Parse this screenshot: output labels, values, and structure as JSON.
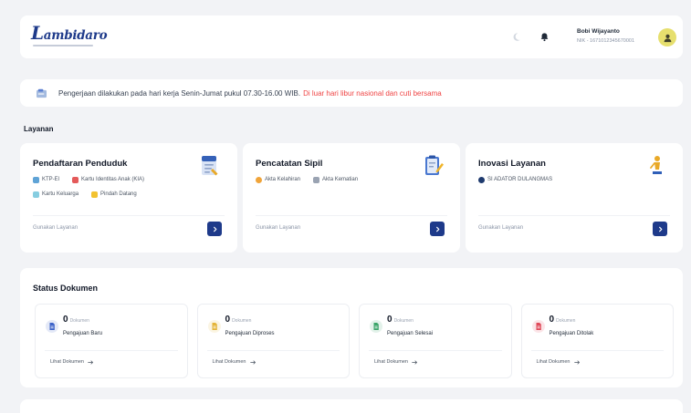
{
  "header": {
    "logo_text": "Lambidaro",
    "user_name": "Bobi Wijayanto",
    "user_id": "NIK - 1671012345670001",
    "icons": {
      "theme": "moon-icon",
      "notification": "bell-icon",
      "avatar": "user-avatar-icon"
    }
  },
  "notice": {
    "icon": "document-icon",
    "text": "Pengerjaan dilakukan pada hari kerja Senin-Jumat pukul 07.30-16.00 WIB.",
    "highlight": "Di luar hari libur nasional dan cuti bersama",
    "highlight_color": "#ef4444"
  },
  "services": {
    "title": "Layanan",
    "cards": [
      {
        "title": "Pendaftaran Penduduk",
        "icon": "id-document-icon",
        "items": [
          {
            "label": "KTP-El",
            "icon": "id-card-icon",
            "color": "#5fa3d6"
          },
          {
            "label": "Kartu Identitas Anak (KIA)",
            "icon": "child-card-icon",
            "color": "#e45a5a"
          },
          {
            "label": "Kartu Keluarga",
            "icon": "family-card-icon",
            "color": "#86cde0"
          },
          {
            "label": "Pindah Datang",
            "icon": "moving-icon",
            "color": "#f2c230"
          }
        ],
        "action_label": "Gunakan Layanan"
      },
      {
        "title": "Pencatatan Sipil",
        "icon": "clipboard-pen-icon",
        "items": [
          {
            "label": "Akta Kelahiran",
            "icon": "birth-certificate-icon",
            "color": "#f0a43a"
          },
          {
            "label": "Akta Kematian",
            "icon": "death-certificate-icon",
            "color": "#9aa3b2"
          }
        ],
        "action_label": "Gunakan Layanan"
      },
      {
        "title": "Inovasi Layanan",
        "icon": "award-person-icon",
        "items": [
          {
            "label": "SI ADATOR DULANGMAS",
            "icon": "innovation-icon",
            "color": "#1e3a6e"
          }
        ],
        "action_label": "Gunakan Layanan"
      }
    ]
  },
  "status": {
    "title": "Status Dokumen",
    "items": [
      {
        "count": "0",
        "unit": "Dokumen",
        "label": "Pengajuan Baru",
        "link": "Lihat Dokumen",
        "icon": "document-new-icon",
        "color": "#3d63c9"
      },
      {
        "count": "0",
        "unit": "Dokumen",
        "label": "Pengajuan Diproses",
        "link": "Lihat Dokumen",
        "icon": "document-process-icon",
        "color": "#e4b53a"
      },
      {
        "count": "0",
        "unit": "Dokumen",
        "label": "Pengajuan Selesai",
        "link": "Lihat Dokumen",
        "icon": "document-done-icon",
        "color": "#3ca56a"
      },
      {
        "count": "0",
        "unit": "Dokumen",
        "label": "Pengajuan Ditolak",
        "link": "Lihat Dokumen",
        "icon": "document-rejected-icon",
        "color": "#e04a5a"
      }
    ]
  },
  "colors": {
    "primary": "#1e3a8a",
    "background": "#f2f3f6"
  }
}
